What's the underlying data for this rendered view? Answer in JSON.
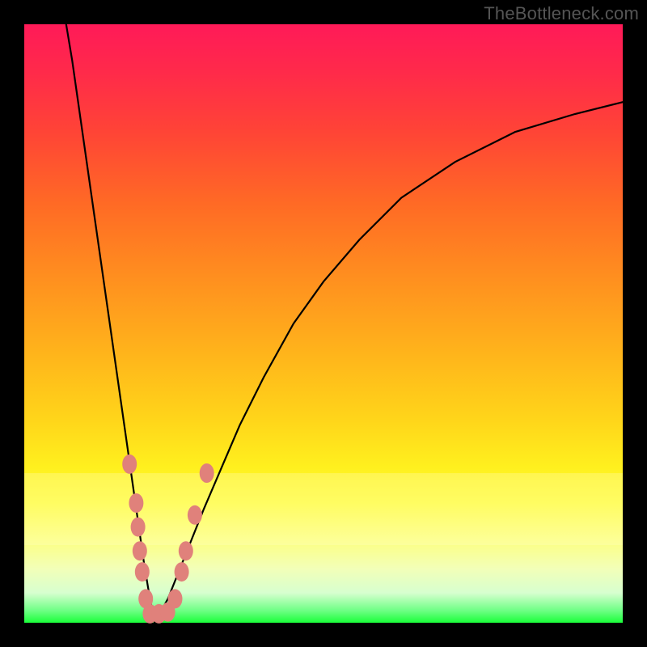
{
  "watermark": "TheBottleneck.com",
  "colors": {
    "dot": "#e0817b",
    "curve": "#000000",
    "frame": "#000000"
  },
  "chart_data": {
    "type": "line",
    "title": "",
    "xlabel": "",
    "ylabel": "",
    "xlim": [
      0,
      100
    ],
    "ylim": [
      0,
      100
    ],
    "series": [
      {
        "name": "bottleneck-curve-left",
        "x": [
          7,
          8,
          9,
          10,
          11,
          12,
          13,
          14,
          15,
          16,
          17,
          18,
          19,
          20,
          21,
          21.8
        ],
        "y": [
          100,
          94,
          87,
          80,
          73,
          66,
          59,
          52,
          45,
          38,
          31,
          24,
          17,
          10,
          4,
          0
        ]
      },
      {
        "name": "bottleneck-curve-right",
        "x": [
          21.8,
          24,
          26,
          28,
          30,
          33,
          36,
          40,
          45,
          50,
          56,
          63,
          72,
          82,
          92,
          100
        ],
        "y": [
          0,
          4,
          9,
          14,
          19,
          26,
          33,
          41,
          50,
          57,
          64,
          71,
          77,
          82,
          85,
          87
        ]
      }
    ],
    "points": {
      "name": "sample-dots",
      "coords": [
        [
          17.6,
          26.5
        ],
        [
          18.7,
          20.0
        ],
        [
          19.0,
          16.0
        ],
        [
          19.3,
          12.0
        ],
        [
          19.7,
          8.5
        ],
        [
          20.3,
          4.0
        ],
        [
          21.0,
          1.5
        ],
        [
          22.5,
          1.5
        ],
        [
          24.0,
          1.8
        ],
        [
          25.2,
          4.0
        ],
        [
          26.3,
          8.5
        ],
        [
          27.0,
          12.0
        ],
        [
          28.5,
          18.0
        ],
        [
          30.5,
          25.0
        ]
      ]
    },
    "yellow_band_y_range": [
      13,
      25
    ]
  }
}
